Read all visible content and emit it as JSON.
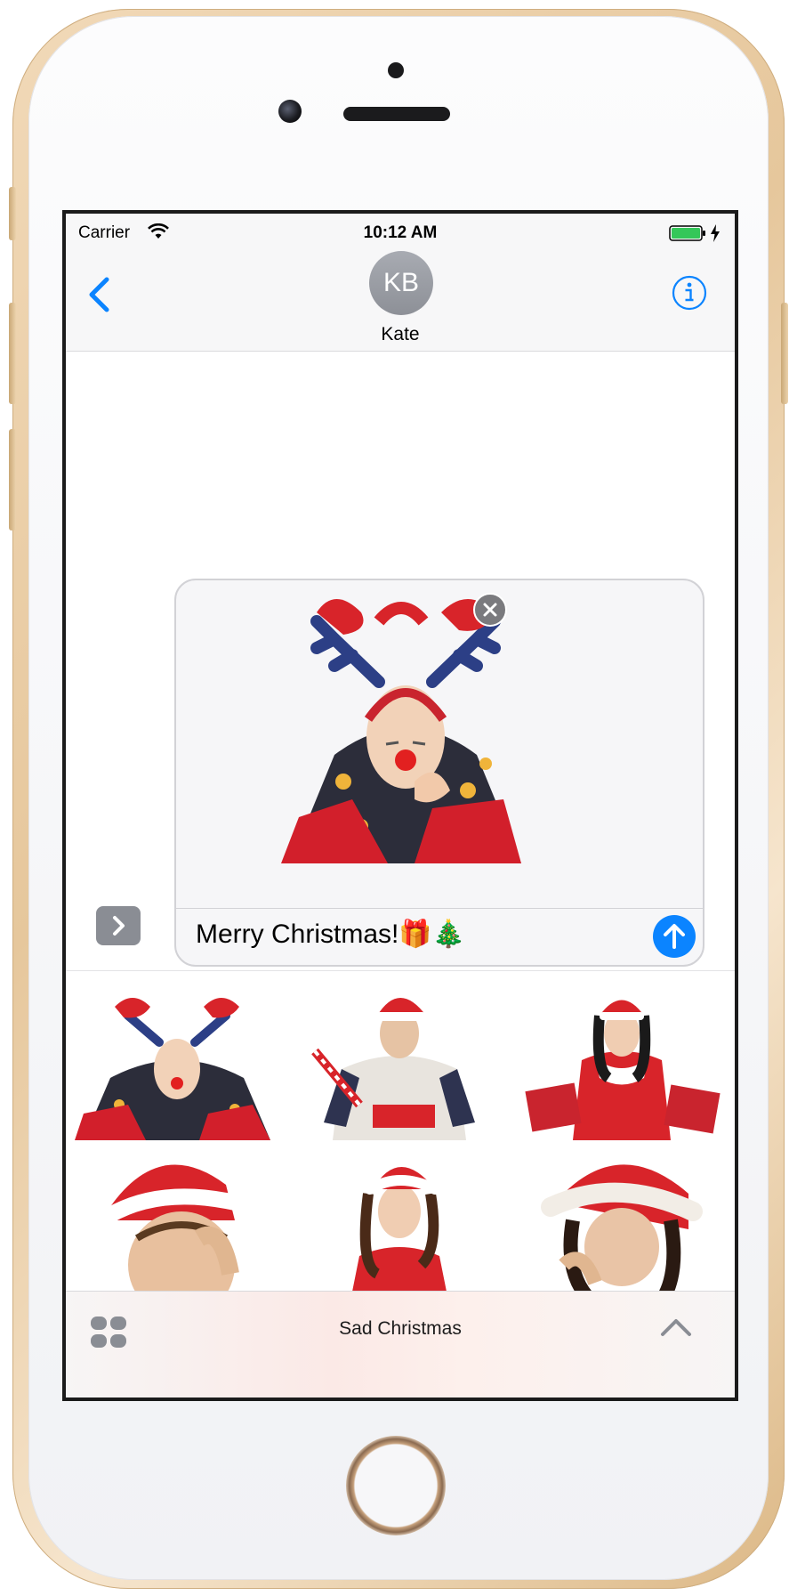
{
  "status_bar": {
    "carrier": "Carrier",
    "time": "10:12 AM",
    "battery_color": "#34c759",
    "icons": [
      "wifi-icon",
      "battery-icon",
      "charging-bolt-icon"
    ]
  },
  "header": {
    "avatar_initials": "KB",
    "contact_name": "Kate",
    "accent_color": "#0b84ff",
    "icons": [
      "chevron-left-icon",
      "info-icon"
    ]
  },
  "compose": {
    "message_text": "Merry Christmas!🎁🎄",
    "attached_sticker": "reindeer-antlers-man-sticker",
    "icons": [
      "close-icon",
      "arrow-up-icon",
      "chevron-right-icon"
    ]
  },
  "drawer": {
    "title": "Sad Christmas",
    "stickers": [
      "reindeer-antlers-man-sticker",
      "man-with-gift-box-sticker",
      "woman-with-gift-boxes-sticker",
      "man-in-santa-hat-sticker",
      "woman-in-santa-hat-sticker",
      "woman-resting-head-sticker"
    ],
    "icons": [
      "app-grid-icon",
      "chevron-up-icon"
    ]
  }
}
